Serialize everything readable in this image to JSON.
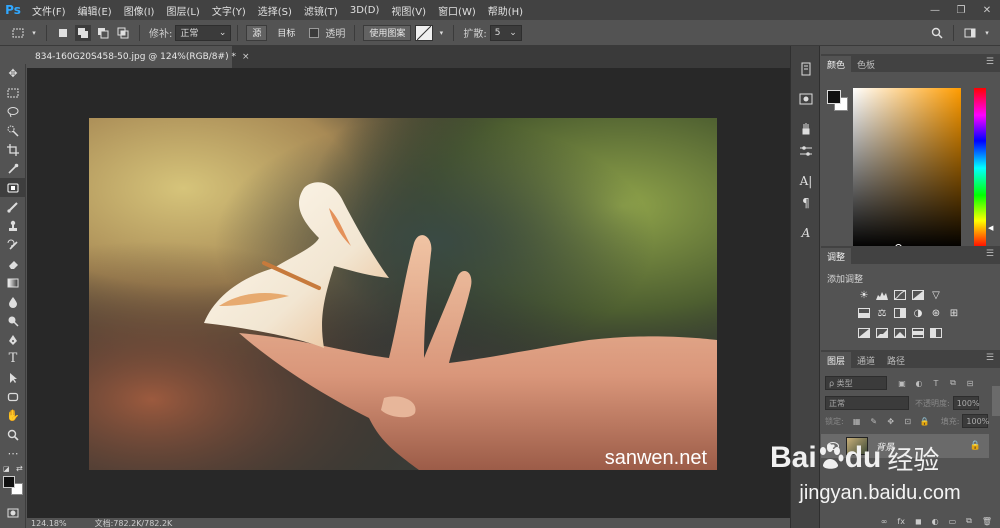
{
  "app": {
    "logo": "Ps"
  },
  "menu": [
    "文件(F)",
    "编辑(E)",
    "图像(I)",
    "图层(L)",
    "文字(Y)",
    "选择(S)",
    "滤镜(T)",
    "3D(D)",
    "视图(V)",
    "窗口(W)",
    "帮助(H)"
  ],
  "window_controls": {
    "minimize": "—",
    "restore": "❐",
    "close": "✕"
  },
  "options": {
    "repair_label": "修补:",
    "repair_mode": "正常",
    "source_btn": "源",
    "dest_btn": "目标",
    "transparent_label": "透明",
    "use_pattern_btn": "使用图案",
    "diffusion_label": "扩散:",
    "diffusion_value": "5"
  },
  "document": {
    "tab_title": "834-160G20S458-50.jpg @ 124%(RGB/8#) *",
    "close": "×",
    "image_watermark": "sanwen.net"
  },
  "status": {
    "zoom": "124.18%",
    "doc_info": "文档:782.2K/782.2K"
  },
  "panels": {
    "color_tabs": [
      "颜色",
      "色板"
    ],
    "adjust_tab": "调整",
    "adjust_title": "添加调整",
    "layers_tabs": [
      "图层",
      "通道",
      "路径"
    ],
    "layer_kind": "ρ 类型",
    "blend_mode": "正常",
    "opacity_label": "不透明度:",
    "opacity_value": "100%",
    "lock_label": "锁定:",
    "fill_label": "填充:",
    "fill_value": "100%",
    "layer_name": "背景",
    "footer_icons": [
      "∞",
      "fx",
      "◼",
      "◐",
      "▭",
      "⧉",
      "🗑"
    ]
  },
  "watermark": {
    "baidu_text": "Bai",
    "baidu_text2": "du",
    "jingyan": "经验",
    "url": "jingyan.baidu.com"
  },
  "colors": {
    "foreground": "#111111",
    "background": "#ffffff",
    "picker_hue": "#ff9c00"
  }
}
